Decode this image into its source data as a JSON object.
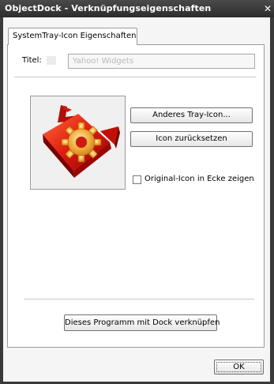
{
  "window": {
    "title": "ObjectDock - Verknüpfungseigenschaften",
    "close_glyph": "✕"
  },
  "tab": {
    "label": "SystemTray-Icon Eigenschaften"
  },
  "title_field": {
    "label": "Titel:",
    "value": "Yahoo! Widgets"
  },
  "icon": {
    "name": "red-gear-arrow-icon"
  },
  "buttons": {
    "other_icon": "Anderes Tray-Icon...",
    "reset_icon": "Icon zurücksetzen",
    "link_dock": "Dieses Programm mit Dock verknüpfen",
    "ok": "OK"
  },
  "checkbox": {
    "label": "Original-Icon in Ecke zeigen",
    "checked": false
  }
}
